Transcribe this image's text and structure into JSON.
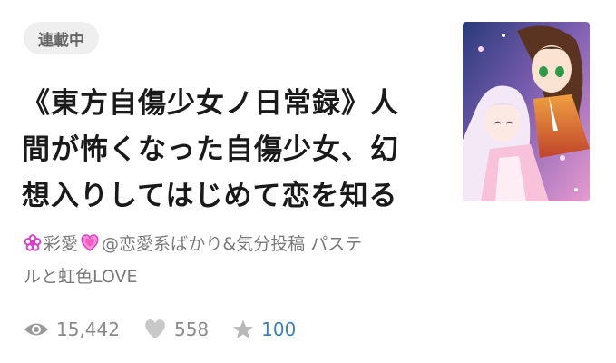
{
  "status_badge": "連載中",
  "title_lines": [
    "《東方自傷少女ノ日常録》人",
    "間が怖くなった自傷少女、幻",
    "想入りしてはじめて恋を知る"
  ],
  "author": {
    "name_part1": "彩愛",
    "name_part2": "@恋愛系ばかり&気分投稿 パステ",
    "name_line2": "ルと虹色LOVE",
    "flower_icon": "flower-icon",
    "heart_icon": "heart-icon"
  },
  "stats": {
    "views": "15,442",
    "likes": "558",
    "stars": "100"
  },
  "colors": {
    "accent_stars": "#3d82b5",
    "author_icon": "#d642c8",
    "badge_bg": "#efefef"
  }
}
